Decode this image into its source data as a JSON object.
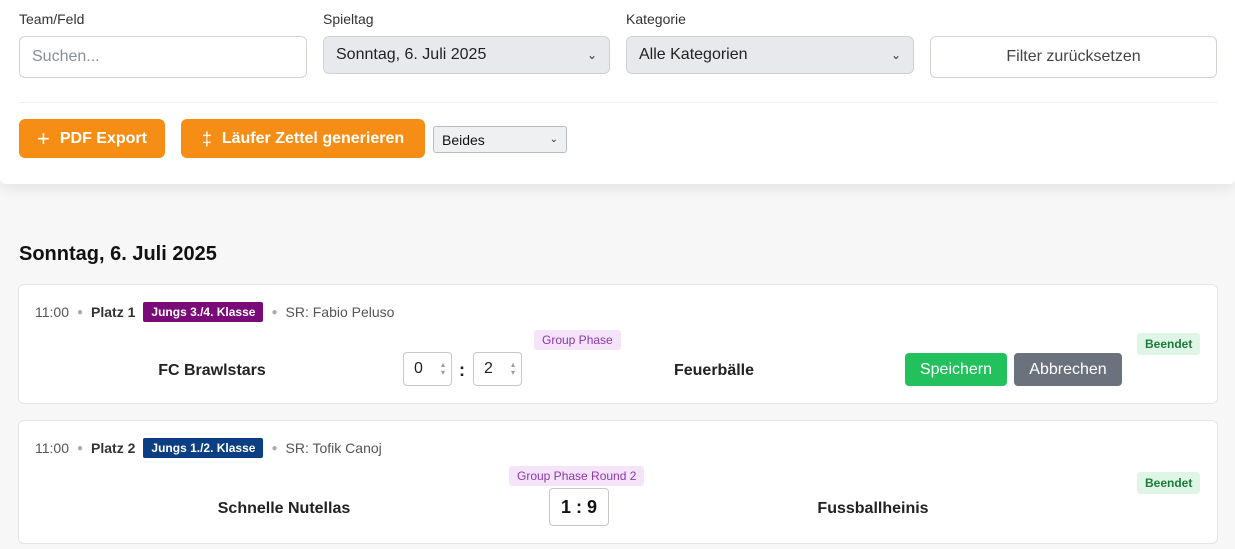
{
  "filters": {
    "team_label": "Team/Feld",
    "search_placeholder": "Suchen...",
    "spieltag_label": "Spieltag",
    "spieltag_value": "Sonntag, 6. Juli 2025",
    "kategorie_label": "Kategorie",
    "kategorie_value": "Alle Kategorien",
    "reset_label": "Filter zurücksetzen"
  },
  "actions": {
    "pdf_export_label": "PDF Export",
    "laeufer_label": "Läufer Zettel generieren",
    "mode_select_value": "Beides"
  },
  "day_title": "Sonntag, 6. Juli 2025",
  "matches": [
    {
      "time": "11:00",
      "field": "Platz 1",
      "category": "Jungs 3./4. Klasse",
      "category_color": "#7a0a78",
      "referee": "SR: Fabio Peluso",
      "phase": "Group Phase",
      "status": "Beendet",
      "home": "FC Brawlstars",
      "away": "Feuerbälle",
      "home_score": "0",
      "away_score": "2",
      "colon": ":",
      "save_label": "Speichern",
      "cancel_label": "Abbrechen"
    },
    {
      "time": "11:00",
      "field": "Platz 2",
      "category": "Jungs 1./2. Klasse",
      "category_color": "#0b3e82",
      "referee": "SR: Tofik Canoj",
      "phase": "Group Phase Round 2",
      "status": "Beendet",
      "home": "Schnelle Nutellas",
      "away": "Fussballheinis",
      "score": "1 : 9"
    }
  ]
}
